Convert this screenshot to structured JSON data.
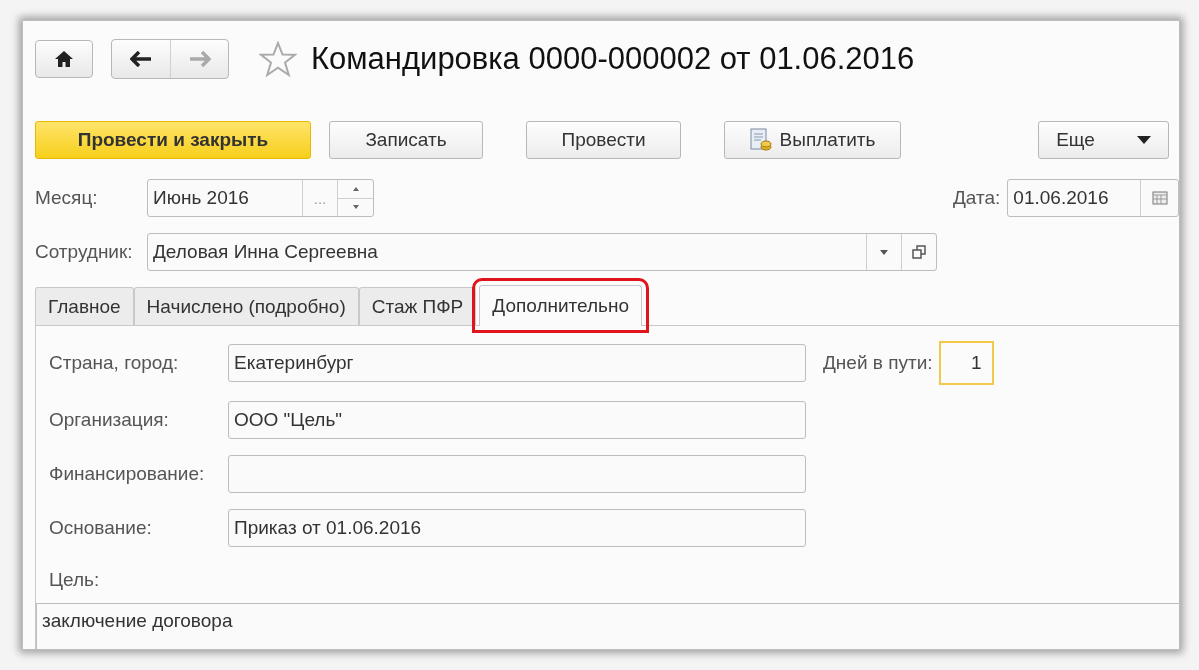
{
  "header": {
    "title": "Командировка 0000-000002 от 01.06.2016"
  },
  "buttons": [
    {
      "label": "Провести и закрыть",
      "kind": "primary"
    },
    {
      "label": "Записать",
      "kind": "plain"
    },
    {
      "label": "Провести",
      "kind": "plain"
    },
    {
      "label": "Выплатить",
      "kind": "icon"
    },
    {
      "label": "Еще",
      "kind": "menu"
    }
  ],
  "month": {
    "label": "Месяц:",
    "value": "Июнь 2016",
    "choose": "..."
  },
  "date": {
    "label": "Дата:",
    "value": "01.06.2016"
  },
  "employee": {
    "label": "Сотрудник:",
    "value": "Деловая Инна Сергеевна"
  },
  "tabs": [
    {
      "label": "Главное",
      "selected": false,
      "highlighted": false
    },
    {
      "label": "Начислено (подробно)",
      "selected": false,
      "highlighted": false
    },
    {
      "label": "Стаж ПФР",
      "selected": false,
      "highlighted": false
    },
    {
      "label": "Дополнительно",
      "selected": true,
      "highlighted": true
    }
  ],
  "fields": [
    {
      "label": "Страна, город:",
      "value": "Екатеринбург"
    },
    {
      "label": "Организация:",
      "value": "ООО \"Цель\""
    },
    {
      "label": "Финансирование:"
    },
    {
      "label": "Основание:",
      "value": "Приказ от 01.06.2016"
    }
  ],
  "days_on_road": {
    "label": "Дней в пути:",
    "value": "1"
  },
  "purpose": {
    "label": "Цель:",
    "value": "заключение договора"
  }
}
